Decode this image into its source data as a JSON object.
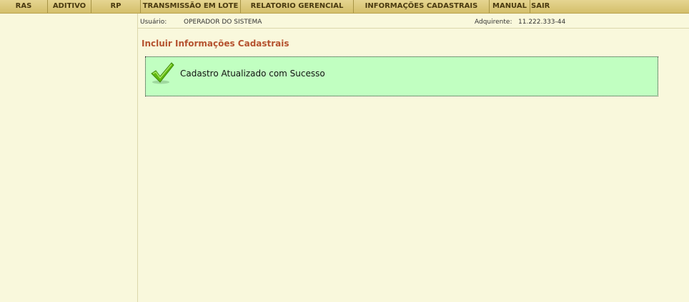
{
  "menu": {
    "items": [
      {
        "label": "RAS"
      },
      {
        "label": "ADITIVO"
      },
      {
        "label": "RP"
      },
      {
        "label": "TRANSMISSÃO EM LOTE"
      },
      {
        "label": "RELATORIO GERENCIAL"
      },
      {
        "label": "INFORMAÇÕES CADASTRAIS"
      },
      {
        "label": "MANUAL"
      },
      {
        "label": "SAIR"
      }
    ]
  },
  "userbar": {
    "user_label": "Usuário:",
    "user_value": "OPERADOR DO SISTEMA",
    "acquirer_label": "Adquirente:",
    "acquirer_value": "11.222.333-44"
  },
  "main": {
    "title": "Incluir Informações Cadastrais",
    "message": {
      "icon": "checkmark-icon",
      "text": "Cadastro Atualizado com Sucesso",
      "background": "#c1ffc1"
    }
  },
  "colors": {
    "menubar": "#d4bf6b",
    "page_background": "#f9f8dc",
    "title": "#b5522f",
    "check": "#5fb80f"
  }
}
